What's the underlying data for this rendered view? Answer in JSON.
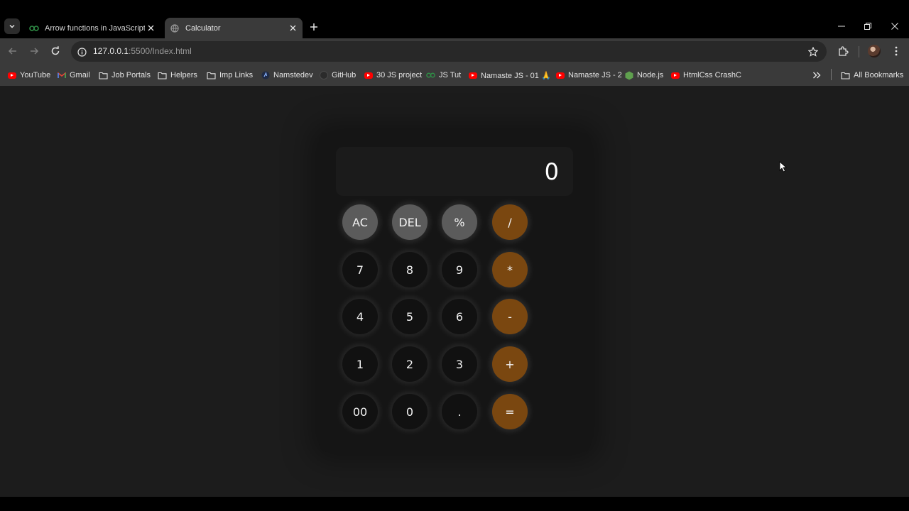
{
  "browser": {
    "tabs": [
      {
        "title": "Arrow functions in JavaScript - ",
        "favicon": "geeksforgeeks-icon",
        "active": false
      },
      {
        "title": "Calculator",
        "favicon": "globe-icon",
        "active": true
      }
    ],
    "url_host": "127.0.0.1",
    "url_rest": ":5500/Index.html",
    "bookmarks": [
      {
        "label": "YouTube",
        "icon": "youtube-icon"
      },
      {
        "label": "Gmail",
        "icon": "gmail-icon"
      },
      {
        "label": "Job Portals",
        "icon": "folder-icon"
      },
      {
        "label": "Helpers",
        "icon": "folder-icon"
      },
      {
        "label": "Imp Links",
        "icon": "folder-icon"
      },
      {
        "label": "Namstedev",
        "icon": "namastedev-icon"
      },
      {
        "label": "GitHub",
        "icon": "github-icon"
      },
      {
        "label": "30 JS project",
        "icon": "youtube-icon"
      },
      {
        "label": "JS Tut",
        "icon": "geeksforgeeks-icon"
      },
      {
        "label": "Namaste JS - 01 🙏",
        "icon": "youtube-icon"
      },
      {
        "label": "Namaste JS - 2",
        "icon": "youtube-icon"
      },
      {
        "label": "Node.js",
        "icon": "nodejs-icon"
      },
      {
        "label": "HtmlCss CrashC",
        "icon": "youtube-icon"
      }
    ],
    "all_bookmarks_label": "All Bookmarks"
  },
  "calculator": {
    "display": "0",
    "rows": [
      [
        {
          "label": "AC",
          "kind": "fn"
        },
        {
          "label": "DEL",
          "kind": "fn"
        },
        {
          "label": "%",
          "kind": "fn"
        },
        {
          "label": "/",
          "kind": "op"
        }
      ],
      [
        {
          "label": "7",
          "kind": "num"
        },
        {
          "label": "8",
          "kind": "num"
        },
        {
          "label": "9",
          "kind": "num"
        },
        {
          "label": "*",
          "kind": "op"
        }
      ],
      [
        {
          "label": "4",
          "kind": "num"
        },
        {
          "label": "5",
          "kind": "num"
        },
        {
          "label": "6",
          "kind": "num"
        },
        {
          "label": "-",
          "kind": "op"
        }
      ],
      [
        {
          "label": "1",
          "kind": "num"
        },
        {
          "label": "2",
          "kind": "num"
        },
        {
          "label": "3",
          "kind": "num"
        },
        {
          "label": "+",
          "kind": "op"
        }
      ],
      [
        {
          "label": "00",
          "kind": "num"
        },
        {
          "label": "0",
          "kind": "num"
        },
        {
          "label": ".",
          "kind": "num"
        },
        {
          "label": "=",
          "kind": "op"
        }
      ]
    ]
  },
  "colors": {
    "operator_key": "#7a4710",
    "function_key": "#5b5b5b",
    "number_key": "#111111",
    "page_background": "#1c1c1c"
  }
}
